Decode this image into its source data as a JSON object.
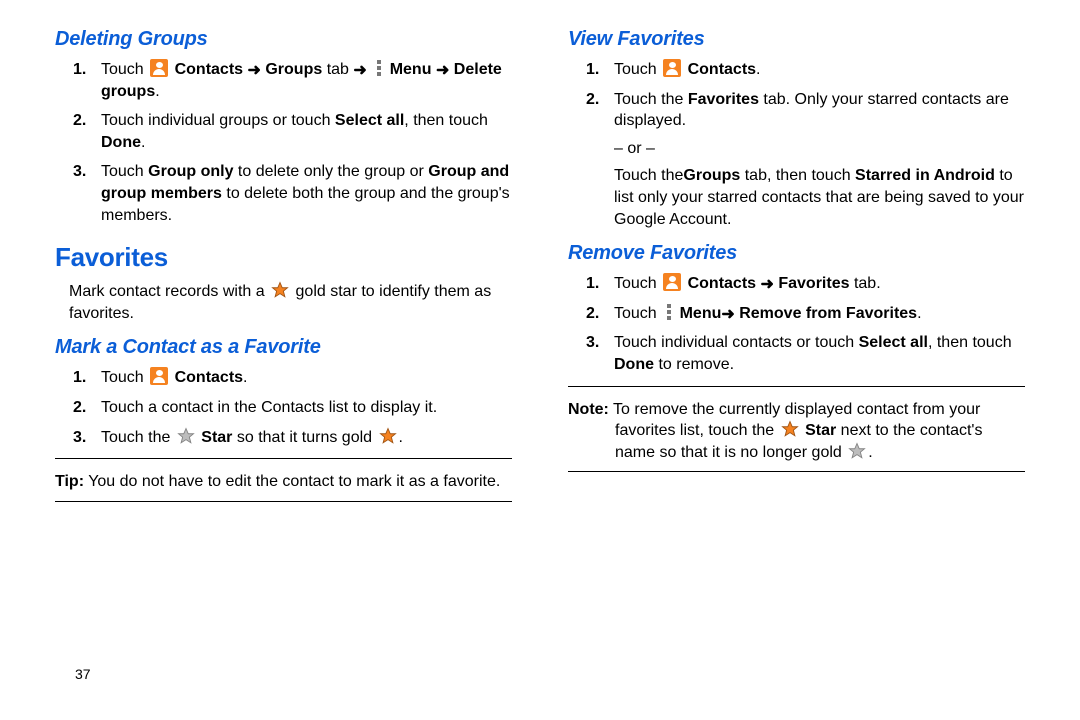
{
  "left": {
    "heading_deleting_groups": "Deleting Groups",
    "del_steps": {
      "s1_a": "Touch ",
      "s1_contacts": "Contacts",
      "s1_b": " ",
      "s1_groups_tab": "Groups",
      "s1_tab_word": " tab ",
      "s1_menu": "Menu",
      "s1_c": " ",
      "s1_delete_groups": "Delete groups",
      "s1_d": ".",
      "s2_a": "Touch individual groups or touch ",
      "s2_select_all": "Select all",
      "s2_b": ", then touch ",
      "s2_done": "Done",
      "s2_c": ".",
      "s3_a": "Touch ",
      "s3_group_only": "Group only",
      "s3_b": " to delete only the group or ",
      "s3_group_and_members": "Group and group members",
      "s3_c": " to delete both the group and the group's members."
    },
    "heading_favorites": "Favorites",
    "fav_intro_a": "Mark contact records with a ",
    "fav_intro_b": " gold star to identify them as favorites.",
    "heading_mark_fav": "Mark a Contact as a Favorite",
    "mark_steps": {
      "s1_a": "Touch ",
      "s1_contacts": "Contacts",
      "s1_b": ".",
      "s2": "Touch a contact in the Contacts list  to display it.",
      "s3_a": "Touch the ",
      "s3_star": "Star",
      "s3_b": " so that it turns gold ",
      "s3_c": "."
    },
    "tip_label": "Tip:",
    "tip_body": " You do not have to edit the contact to mark it as a favorite."
  },
  "right": {
    "heading_view_fav": "View Favorites",
    "view_steps": {
      "s1_a": "Touch ",
      "s1_contacts": "Contacts",
      "s1_b": ".",
      "s2_a": "Touch the ",
      "s2_fav": "Favorites",
      "s2_b": " tab. Only your starred contacts are displayed.",
      "or": "– or –",
      "alt_a": "Touch the",
      "alt_groups": "Groups",
      "alt_b": "  tab, then touch ",
      "alt_starred": "Starred in Android",
      "alt_c": " to list only your starred contacts that are being saved to your Google Account."
    },
    "heading_remove_fav": "Remove Favorites",
    "rem_steps": {
      "s1_a": "Touch ",
      "s1_contacts": "Contacts",
      "s1_b": " ",
      "s1_fav_tab": "Favorites",
      "s1_c": " tab.",
      "s2_a": "Touch ",
      "s2_menu": "Menu",
      "s2_remove": " Remove from Favorites",
      "s2_c": ".",
      "s3_a": "Touch individual contacts or touch ",
      "s3_select_all": "Select all",
      "s3_b": ", then touch ",
      "s3_done": "Done",
      "s3_c": " to remove."
    },
    "note_label": "Note:",
    "note_a": " To remove the currently displayed contact from your favorites list, touch the ",
    "note_star": "Star",
    "note_b": " next to the contact's name so that it is no longer gold ",
    "note_c": "."
  },
  "page_number": "37",
  "arrow": "➜"
}
